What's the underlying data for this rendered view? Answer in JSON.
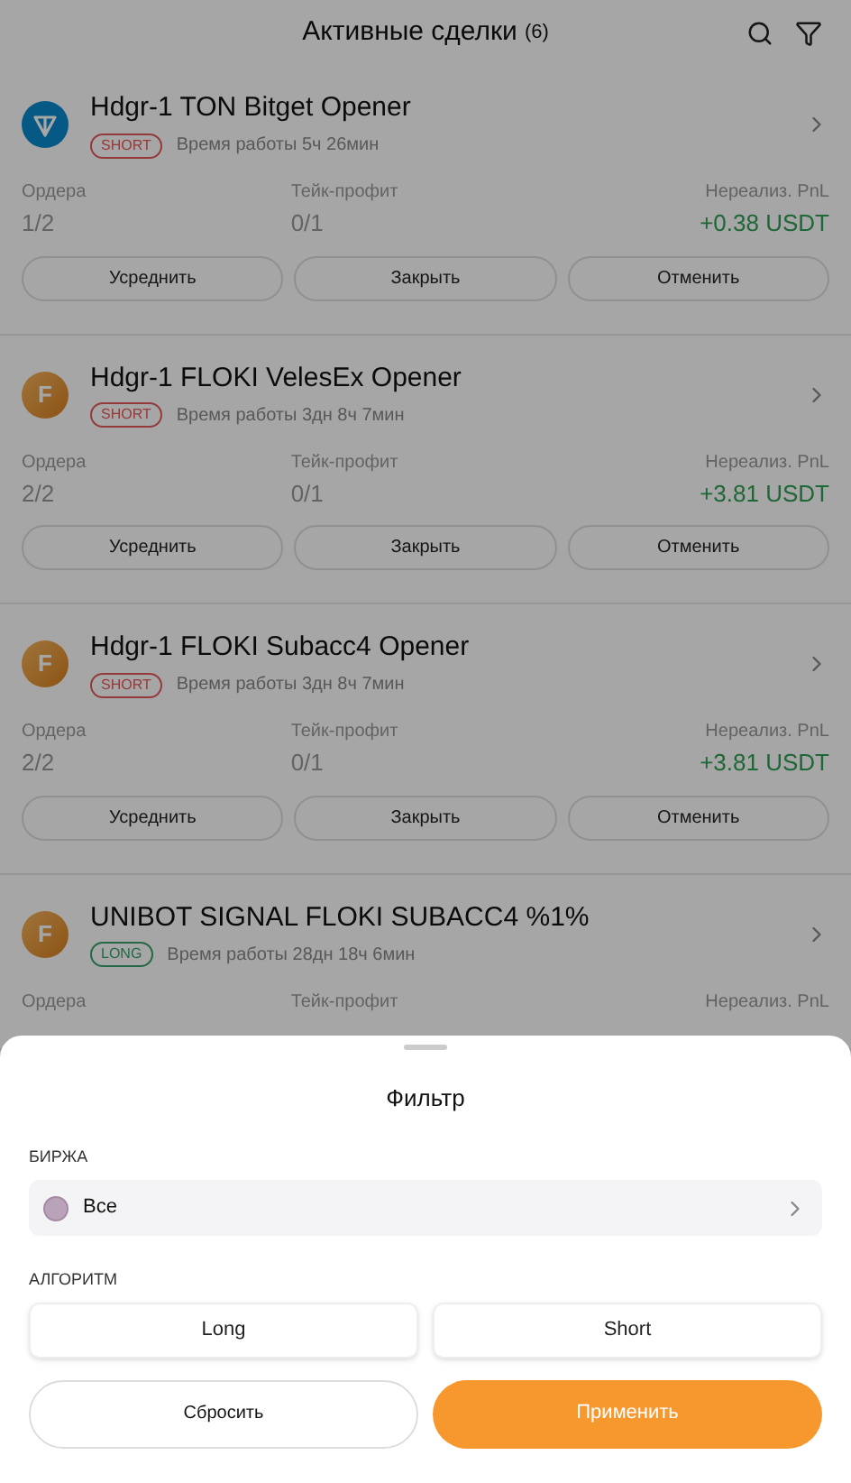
{
  "header": {
    "title": "Активные сделки",
    "count": "(6)"
  },
  "deals": [
    {
      "coin": {
        "kind": "ton"
      },
      "name": "Hdgr-1 TON Bitget Opener",
      "side": {
        "kind": "short",
        "label": "SHORT"
      },
      "uptime": "Время работы 5ч 26мин",
      "orders_label": "Ордера",
      "orders": "1/2",
      "tp_label": "Тейк-профит",
      "tp": "0/1",
      "pnl_label": "Нереализ. PnL",
      "pnl": {
        "text": "+0.38 USDT",
        "kind": "gain"
      },
      "actions": [
        "Усреднить",
        "Закрыть",
        "Отменить"
      ]
    },
    {
      "coin": {
        "kind": "letter",
        "letter": "F"
      },
      "name": "Hdgr-1 FLOKI VelesEx Opener",
      "side": {
        "kind": "short",
        "label": "SHORT"
      },
      "uptime": "Время работы 3дн 8ч 7мин",
      "orders_label": "Ордера",
      "orders": "2/2",
      "tp_label": "Тейк-профит",
      "tp": "0/1",
      "pnl_label": "Нереализ. PnL",
      "pnl": {
        "text": "+3.81 USDT",
        "kind": "gain"
      },
      "actions": [
        "Усреднить",
        "Закрыть",
        "Отменить"
      ]
    },
    {
      "coin": {
        "kind": "letter",
        "letter": "F"
      },
      "name": "Hdgr-1 FLOKI Subacc4 Opener",
      "side": {
        "kind": "short",
        "label": "SHORT"
      },
      "uptime": "Время работы 3дн 8ч 7мин",
      "orders_label": "Ордера",
      "orders": "2/2",
      "tp_label": "Тейк-профит",
      "tp": "0/1",
      "pnl_label": "Нереализ. PnL",
      "pnl": {
        "text": "+3.81 USDT",
        "kind": "gain"
      },
      "actions": [
        "Усреднить",
        "Закрыть",
        "Отменить"
      ]
    },
    {
      "coin": {
        "kind": "letter",
        "letter": "F"
      },
      "name": "UNIBOT SIGNAL FLOKI SUBACC4 %1%",
      "side": {
        "kind": "long",
        "label": "LONG"
      },
      "uptime": "Время работы 28дн 18ч 6мин",
      "orders_label": "Ордера",
      "tp_label": "Тейк-профит",
      "pnl_label": "Нереализ. PnL"
    }
  ],
  "filter": {
    "title": "Фильтр",
    "exchange_label": "БИРЖА",
    "exchange": {
      "value": "Все",
      "color": "#b8a3b8"
    },
    "algorithm_label": "АЛГОРИТМ",
    "algorithms": [
      {
        "label": "Long",
        "selected": false
      },
      {
        "label": "Short",
        "selected": false
      }
    ],
    "reset": "Сбросить",
    "apply": "Применить"
  }
}
